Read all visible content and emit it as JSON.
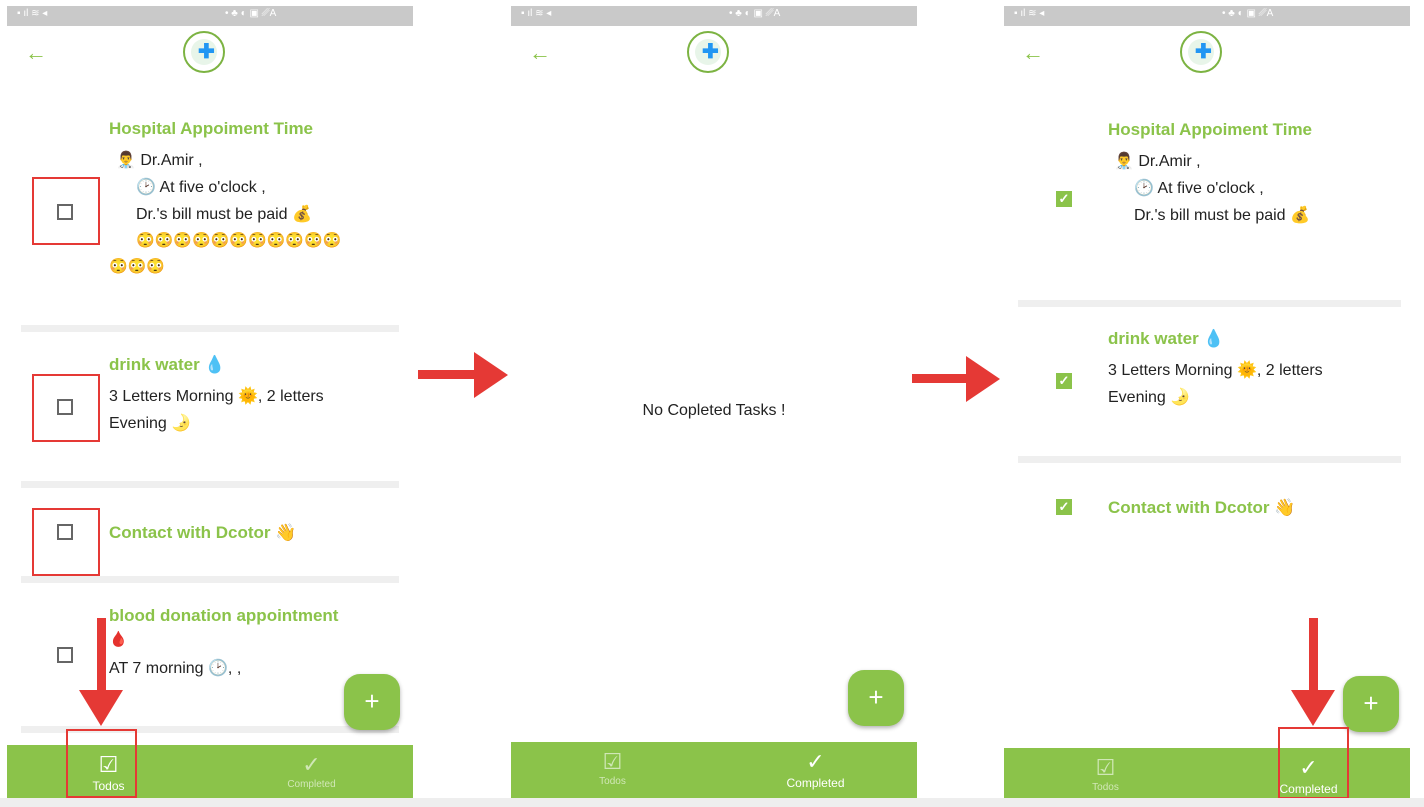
{
  "statusbar": {
    "left": "▪ ıl ≋ ◂",
    "right": "• ♣ ◐ ▣ ␥A"
  },
  "header": {
    "back_icon": "←",
    "logo_icon": "medical-cross-logo",
    "logo_glyph": "✚"
  },
  "todos": [
    {
      "title": "Hospital Appoiment Time",
      "lines": [
        "👨‍⚕️ Dr.Amir ,",
        "🕑 At five o'clock ,",
        "Dr.'s bill must be paid 💰",
        "😳😳😳😳😳😳😳😳😳😳😳",
        "😳😳😳"
      ]
    },
    {
      "title": "drink water 💧",
      "lines": [
        " 3 Letters  Morning 🌞, 2 letters",
        "Evening 🌛"
      ]
    },
    {
      "title": "Contact with Dcotor 👋",
      "lines": []
    },
    {
      "title": "blood donation appointment",
      "lines": [
        "🩸",
        " AT 7 morning 🕑, ,"
      ]
    }
  ],
  "completed_empty_text": "No Copleted Tasks !",
  "completed": [
    {
      "title": "Hospital Appoiment Time",
      "lines": [
        "👨‍⚕️ Dr.Amir ,",
        "🕑 At five o'clock ,",
        "Dr.'s bill must be paid 💰"
      ]
    },
    {
      "title": "drink water 💧",
      "lines": [
        " 3 Letters  Morning 🌞, 2 letters",
        "Evening 🌛"
      ]
    },
    {
      "title": "Contact with Dcotor 👋",
      "lines": []
    }
  ],
  "fab": {
    "label": "+"
  },
  "tabs": {
    "todos": {
      "label": "Todos",
      "icon": "☑"
    },
    "completed": {
      "label": "Completed",
      "icon": "✓"
    }
  },
  "colors": {
    "accent": "#8bc34a",
    "highlight": "#e53935"
  }
}
